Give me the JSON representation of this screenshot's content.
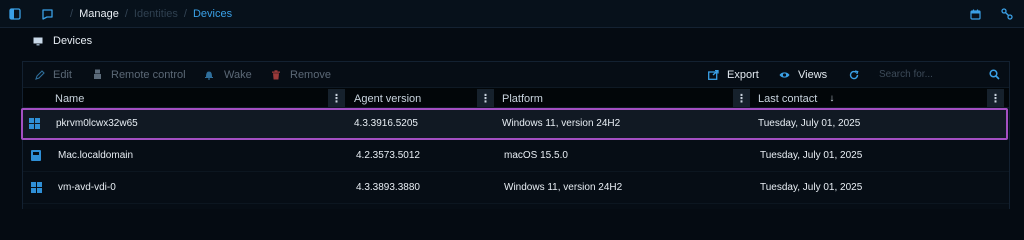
{
  "topbar": {
    "breadcrumb": {
      "manage": "Manage",
      "identities": "Identities",
      "devices": "Devices",
      "separator": "/"
    },
    "colors": {
      "accent": "#3aa0e6",
      "selection_outline": "#a34fc2"
    }
  },
  "page": {
    "title": "Devices"
  },
  "toolbar": {
    "edit": "Edit",
    "remote_control": "Remote control",
    "wake": "Wake",
    "remove": "Remove",
    "export": "Export",
    "views": "Views",
    "search_placeholder": "Search for..."
  },
  "table": {
    "columns": {
      "name": "Name",
      "agent_version": "Agent version",
      "platform": "Platform",
      "last_contact": "Last contact",
      "sort_indicator": "↓",
      "menu_glyph": "⋮"
    },
    "rows": [
      {
        "os_icon": "windows-icon",
        "name": "pkrvm0lcwx32w65",
        "agent_version": "4.3.3916.5205",
        "platform": "Windows 11, version 24H2",
        "last_contact": "Tuesday, July 01, 2025",
        "selected": true
      },
      {
        "os_icon": "mac-icon",
        "name": "Mac.localdomain",
        "agent_version": "4.2.3573.5012",
        "platform": "macOS 15.5.0",
        "last_contact": "Tuesday, July 01, 2025",
        "selected": false
      },
      {
        "os_icon": "windows-icon",
        "name": "vm-avd-vdi-0",
        "agent_version": "4.3.3893.3880",
        "platform": "Windows 11, version 24H2",
        "last_contact": "Tuesday, July 01, 2025",
        "selected": false
      }
    ]
  }
}
